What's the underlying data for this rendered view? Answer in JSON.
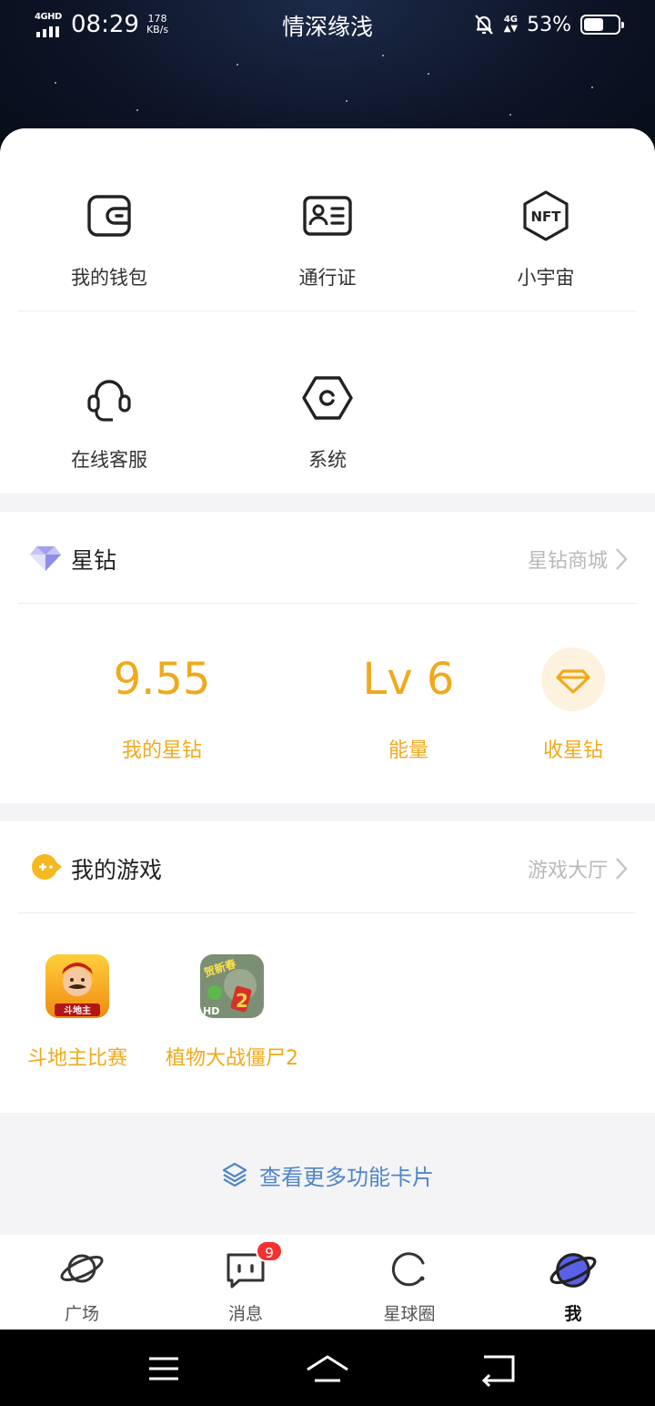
{
  "status_bar": {
    "network_label": "4GHD",
    "time": "08:29",
    "speed_value": "178",
    "speed_unit": "KB/s",
    "title": "情深缘浅",
    "net4g": "4G",
    "battery_text": "53%"
  },
  "quick_actions": {
    "row1": [
      {
        "label": "我的钱包",
        "icon": "wallet-icon"
      },
      {
        "label": "通行证",
        "icon": "id-card-icon"
      },
      {
        "label": "小宇宙",
        "icon": "nft-hexagon-icon"
      }
    ],
    "row2": [
      {
        "label": "在线客服",
        "icon": "headset-icon"
      },
      {
        "label": "系统",
        "icon": "settings-hexagon-icon"
      }
    ]
  },
  "star_diamond": {
    "title": "星钻",
    "link": "星钻商城",
    "balance_value": "9.55",
    "balance_label": "我的星钻",
    "level_value": "Lv 6",
    "level_label": "能量",
    "collect_label": "收星钻"
  },
  "games": {
    "title": "我的游戏",
    "link": "游戏大厅",
    "items": [
      {
        "name": "斗地主比赛",
        "icon_text": "斗地主"
      },
      {
        "name": "植物大战僵尸2",
        "icon_text": "贺新春"
      }
    ],
    "game2_badge": "HD"
  },
  "more_cards": "查看更多功能卡片",
  "tabbar": {
    "tabs": [
      {
        "label": "广场",
        "icon": "planet-outline-icon"
      },
      {
        "label": "消息",
        "icon": "chat-bubble-icon",
        "badge": "9"
      },
      {
        "label": "星球圈",
        "icon": "circle-icon"
      },
      {
        "label": "我",
        "icon": "planet-filled-icon"
      }
    ]
  },
  "colors": {
    "accent_gold": "#f0a91c",
    "link_blue": "#4f86c9",
    "badge_red": "#f3312f"
  }
}
